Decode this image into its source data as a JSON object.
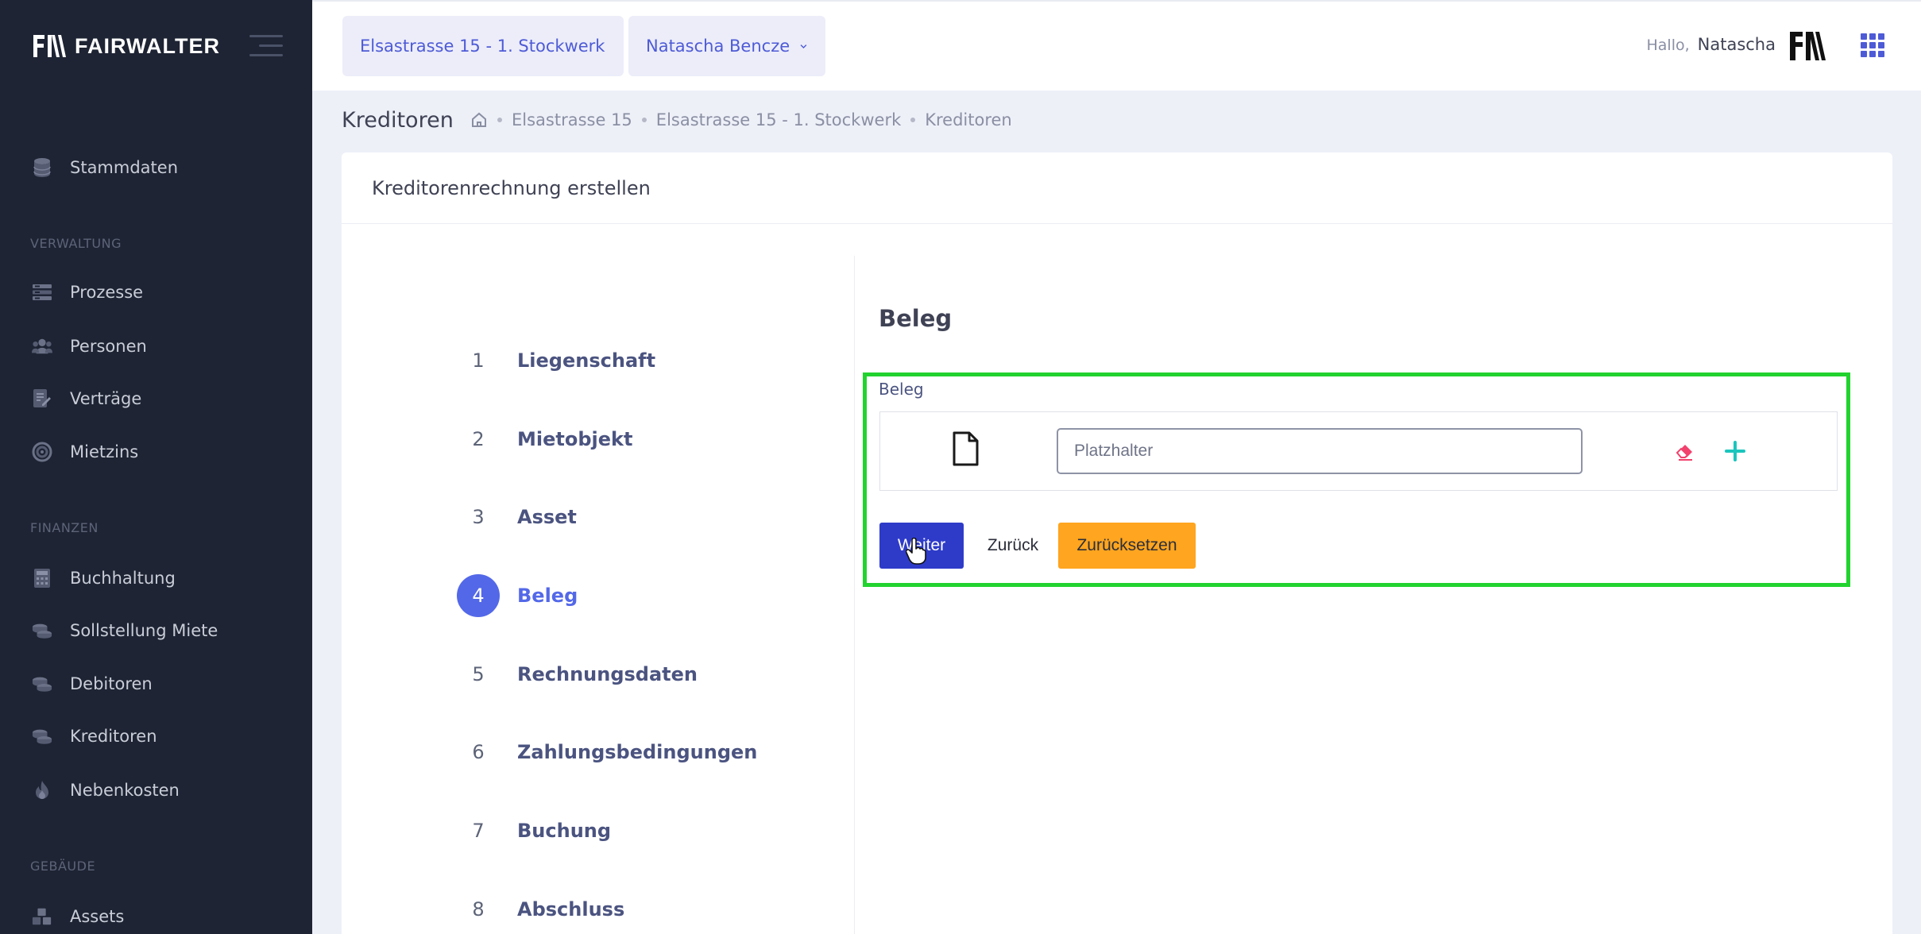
{
  "brand": {
    "name": "FAIRWALTER"
  },
  "sidebar": {
    "items_top": [
      {
        "label": "Stammdaten",
        "icon": "database-icon"
      }
    ],
    "sections": [
      {
        "title": "VERWALTUNG",
        "items": [
          {
            "label": "Prozesse",
            "icon": "list-icon"
          },
          {
            "label": "Personen",
            "icon": "users-icon"
          },
          {
            "label": "Verträge",
            "icon": "contract-icon"
          },
          {
            "label": "Mietzins",
            "icon": "spiral-icon"
          }
        ]
      },
      {
        "title": "FINANZEN",
        "items": [
          {
            "label": "Buchhaltung",
            "icon": "calculator-icon"
          },
          {
            "label": "Sollstellung Miete",
            "icon": "coins-icon"
          },
          {
            "label": "Debitoren",
            "icon": "coins-icon"
          },
          {
            "label": "Kreditoren",
            "icon": "coins-icon"
          },
          {
            "label": "Nebenkosten",
            "icon": "fire-icon"
          }
        ]
      },
      {
        "title": "GEBÄUDE",
        "items": [
          {
            "label": "Assets",
            "icon": "boxes-icon"
          }
        ]
      }
    ]
  },
  "topbar": {
    "property_select": "Elsastrasse 15 - 1. Stockwerk",
    "user_select": "Natascha Bencze",
    "greeting": "Hallo,",
    "username": "Natascha"
  },
  "subheader": {
    "title": "Kreditoren",
    "breadcrumbs": [
      "Elsastrasse 15",
      "Elsastrasse 15 - 1. Stockwerk",
      "Kreditoren"
    ]
  },
  "card": {
    "title": "Kreditorenrechnung erstellen",
    "steps": [
      {
        "num": "1",
        "label": "Liegenschaft"
      },
      {
        "num": "2",
        "label": "Mietobjekt"
      },
      {
        "num": "3",
        "label": "Asset"
      },
      {
        "num": "4",
        "label": "Beleg",
        "active": true
      },
      {
        "num": "5",
        "label": "Rechnungsdaten"
      },
      {
        "num": "6",
        "label": "Zahlungsbedingungen"
      },
      {
        "num": "7",
        "label": "Buchung"
      },
      {
        "num": "8",
        "label": "Abschluss"
      }
    ],
    "section_title": "Beleg",
    "field_label": "Beleg",
    "input_placeholder": "Platzhalter",
    "buttons": {
      "next": "Weiter",
      "back": "Zurück",
      "reset": "Zurücksetzen"
    }
  },
  "colors": {
    "sidebar_bg": "#1e2433",
    "accent": "#5368e8",
    "primary_button": "#2e3bc9",
    "warning_button": "#ffa51f",
    "highlight_border": "#22d32f",
    "eraser": "#f1416c",
    "plus": "#1bc5bd"
  }
}
